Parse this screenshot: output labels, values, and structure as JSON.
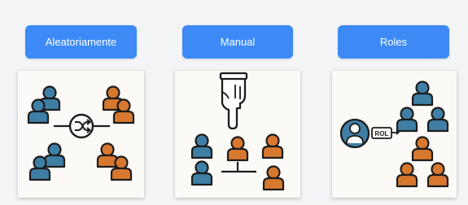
{
  "options": [
    {
      "label": "Aleatoriamente",
      "illustration": "shuffle-assignment-icon"
    },
    {
      "label": "Manual",
      "illustration": "hand-pointer-assignment-icon"
    },
    {
      "label": "Roles",
      "illustration": "role-assignment-icon"
    }
  ],
  "roles_card": {
    "tag": "ROL"
  },
  "colors": {
    "button": "#3d8af7",
    "button_text": "#ffffff",
    "background": "#f3f4f6",
    "card": "#fbfaf7",
    "person_blue": "#3f7fa6",
    "person_orange": "#d8782f",
    "outline": "#1c1c1c"
  }
}
